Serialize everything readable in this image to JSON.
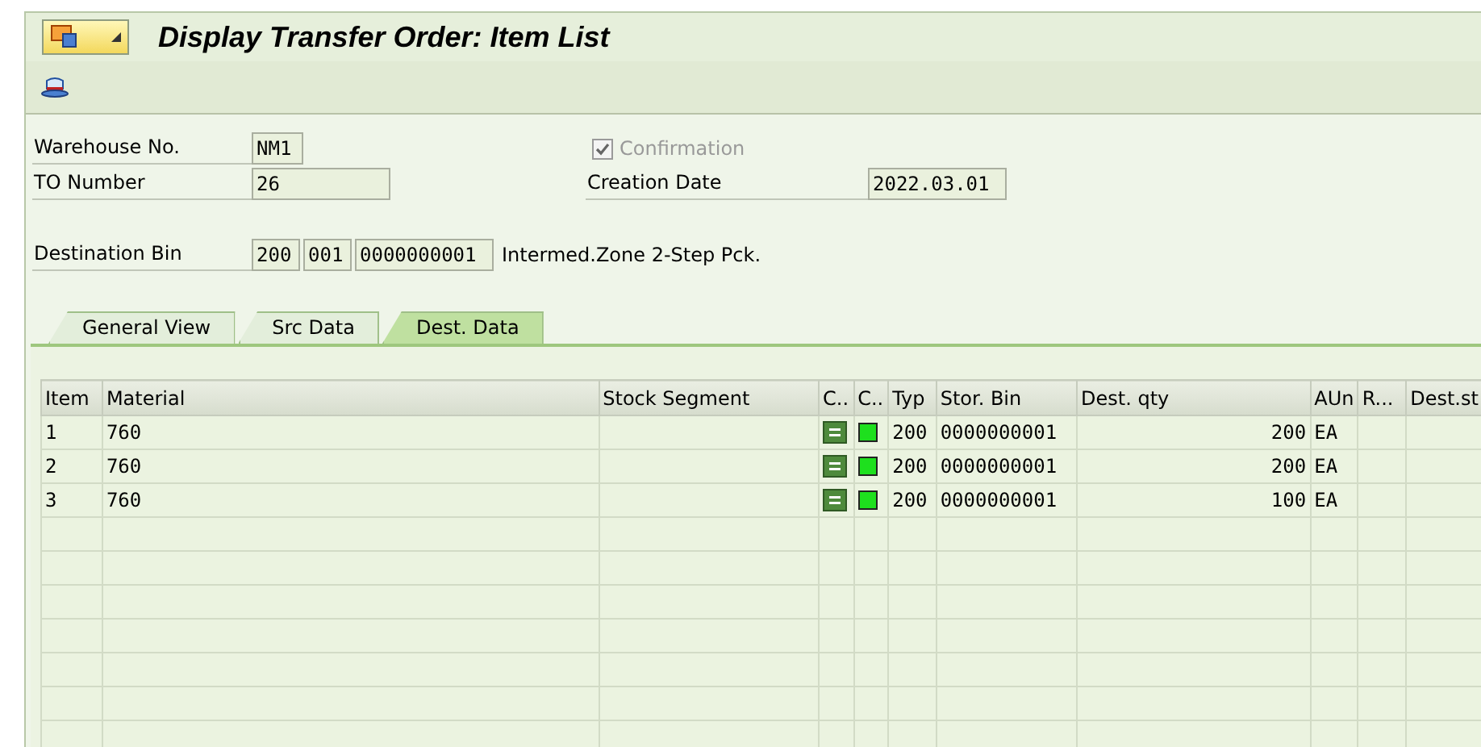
{
  "window": {
    "title": "Display Transfer Order: Item List"
  },
  "header": {
    "warehouse": {
      "label": "Warehouse No.",
      "value": "NM1"
    },
    "confirmation": {
      "label": "Confirmation",
      "checked": true,
      "disabled": true
    },
    "to_number": {
      "label": "TO Number",
      "value": "26"
    },
    "creation_date": {
      "label": "Creation Date",
      "value": "2022.03.01"
    },
    "destination_bin": {
      "label": "Destination Bin",
      "values": [
        "200",
        "001",
        "0000000001"
      ],
      "description": "Intermed.Zone 2-Step Pck."
    }
  },
  "tabs": [
    {
      "label": "General View",
      "selected": false
    },
    {
      "label": "Src Data",
      "selected": false
    },
    {
      "label": "Dest. Data",
      "selected": true
    }
  ],
  "table": {
    "columns": [
      "Item",
      "Material",
      "Stock Segment",
      "C..",
      "C..",
      "Typ",
      "Stor. Bin",
      "Dest. qty",
      "AUn",
      "R...",
      "Dest.st"
    ],
    "rows": [
      {
        "item": "1",
        "material": "760",
        "typ": "200",
        "stor_bin": "0000000001",
        "dest_qty": "200",
        "aun": "EA"
      },
      {
        "item": "2",
        "material": "760",
        "typ": "200",
        "stor_bin": "0000000001",
        "dest_qty": "200",
        "aun": "EA"
      },
      {
        "item": "3",
        "material": "760",
        "typ": "200",
        "stor_bin": "0000000001",
        "dest_qty": "100",
        "aun": "EA"
      }
    ]
  }
}
